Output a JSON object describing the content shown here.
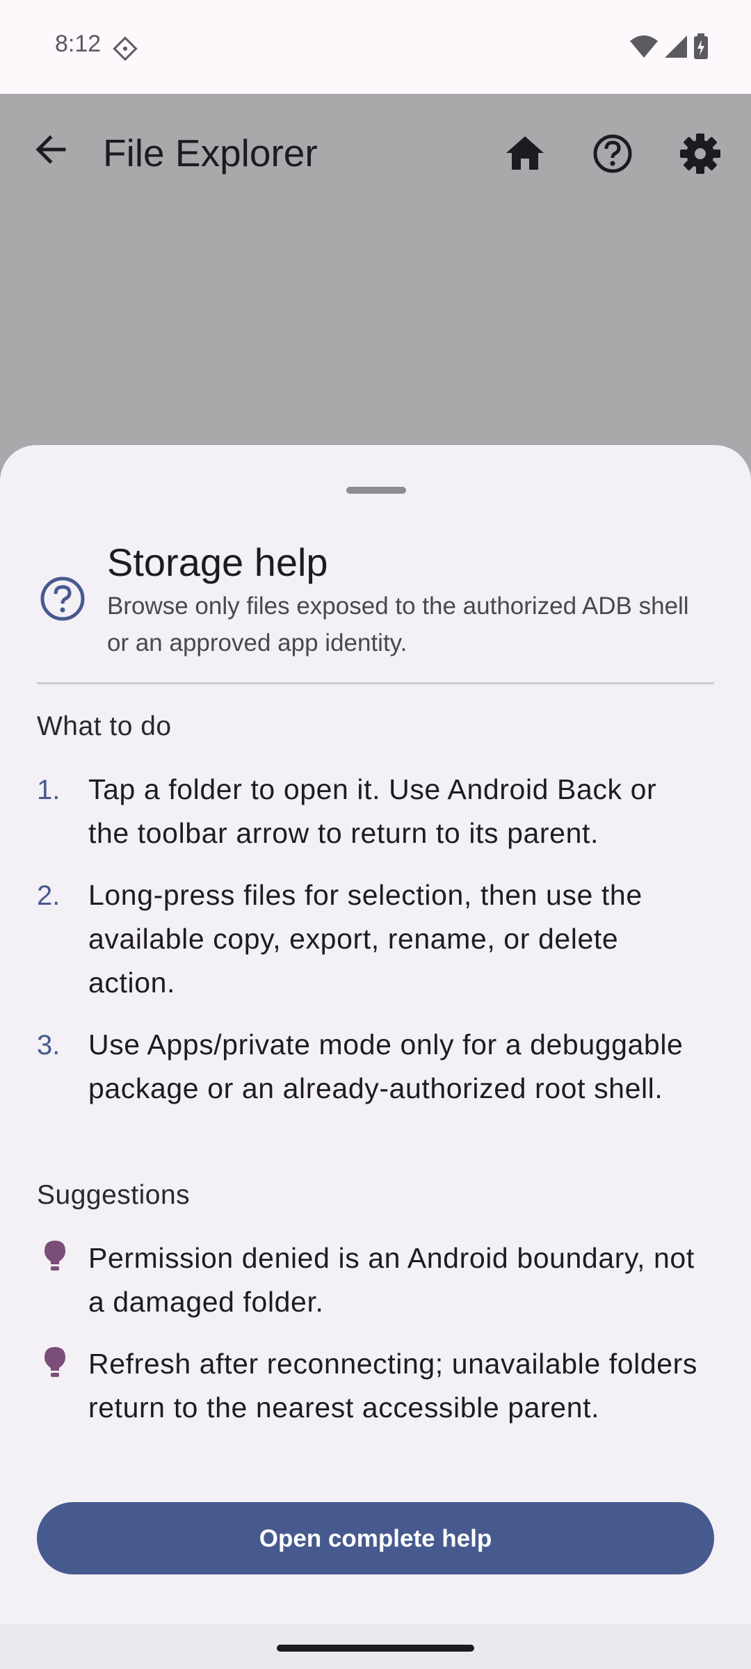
{
  "status_bar": {
    "time": "8:12",
    "icons": [
      "diamond-badge-icon",
      "wifi-icon",
      "signal-icon",
      "battery-charging-icon"
    ]
  },
  "app_bar": {
    "title": "File Explorer",
    "icons": [
      "back-arrow-icon",
      "home-icon",
      "help-icon",
      "settings-icon"
    ]
  },
  "sheet": {
    "title": "Storage help",
    "subtitle": "Browse only files exposed to the authorized ADB shell or an approved app identity.",
    "what_to_do": {
      "heading": "What to do",
      "steps": [
        {
          "num": "1.",
          "text": "Tap a folder to open it. Use Android Back or the toolbar arrow to return to its parent."
        },
        {
          "num": "2.",
          "text": "Long-press files for selection, then use the available copy, export, rename, or delete action."
        },
        {
          "num": "3.",
          "text": "Use Apps/private mode only for a debuggable package or an already-authorized root shell."
        }
      ]
    },
    "suggestions": {
      "heading": "Suggestions",
      "items": [
        {
          "text": "Permission denied is an Android boundary, not a damaged folder."
        },
        {
          "text": "Refresh after reconnecting; unavailable folders return to the nearest accessible parent."
        }
      ]
    },
    "button_label": "Open complete help"
  },
  "colors": {
    "accent": "#475a8f",
    "scrim": "#a9a8ab",
    "sheet_bg": "#f3f0f6",
    "bulb": "#7a4e78"
  }
}
